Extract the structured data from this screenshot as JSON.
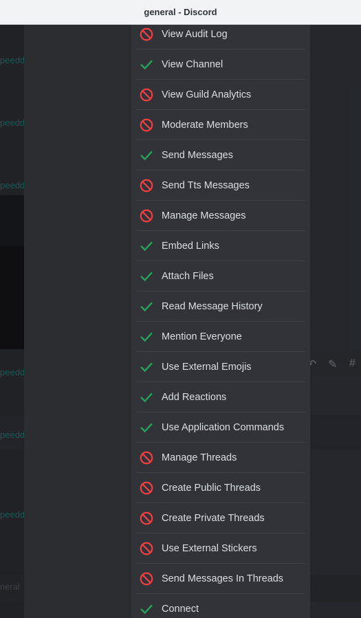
{
  "window": {
    "title": "general - Discord"
  },
  "background": {
    "link_text": "peedd",
    "input_placeholder_partial": "neral",
    "colors": {
      "link": "#1f8b84",
      "chat_bg": "#36393f"
    }
  },
  "permissions": [
    {
      "label": "View Audit Log",
      "allowed": false
    },
    {
      "label": "View Channel",
      "allowed": true
    },
    {
      "label": "View Guild Analytics",
      "allowed": false
    },
    {
      "label": "Moderate Members",
      "allowed": false
    },
    {
      "label": "Send Messages",
      "allowed": true
    },
    {
      "label": "Send Tts Messages",
      "allowed": false
    },
    {
      "label": "Manage Messages",
      "allowed": false
    },
    {
      "label": "Embed Links",
      "allowed": true
    },
    {
      "label": "Attach Files",
      "allowed": true
    },
    {
      "label": "Read Message History",
      "allowed": true
    },
    {
      "label": "Mention Everyone",
      "allowed": true
    },
    {
      "label": "Use External Emojis",
      "allowed": true
    },
    {
      "label": "Add Reactions",
      "allowed": true
    },
    {
      "label": "Use Application Commands",
      "allowed": true
    },
    {
      "label": "Manage Threads",
      "allowed": false
    },
    {
      "label": "Create Public Threads",
      "allowed": false
    },
    {
      "label": "Create Private Threads",
      "allowed": false
    },
    {
      "label": "Use External Stickers",
      "allowed": false
    },
    {
      "label": "Send Messages In Threads",
      "allowed": false
    },
    {
      "label": "Connect",
      "allowed": true
    }
  ],
  "icons": {
    "allowed": "check-icon",
    "denied": "deny-icon"
  },
  "colors": {
    "allowed": "#23a55a",
    "denied": "#f23f43"
  }
}
